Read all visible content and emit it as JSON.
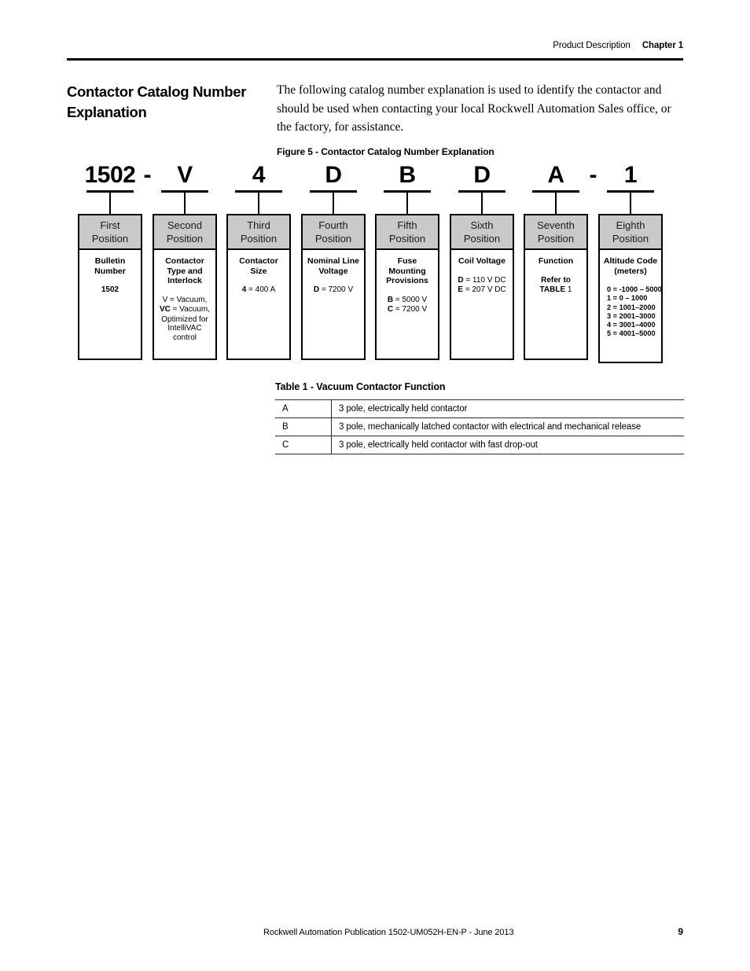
{
  "header": {
    "description": "Product Description",
    "chapter": "Chapter 1"
  },
  "section": {
    "title": "Contactor Catalog Number Explanation",
    "paragraph": "The following catalog number explanation is used to identify the contactor and should be used when contacting your local Rockwell Automation Sales office, or the factory, for assistance."
  },
  "figure": {
    "caption": "Figure 5 - Contactor Catalog Number Explanation",
    "catalog_string": "1502 - V 4 D B D A - 1",
    "characters": [
      "1502",
      "V",
      "4",
      "D",
      "B",
      "D",
      "A",
      "1"
    ],
    "separators": [
      "-",
      "-"
    ],
    "positions": [
      {
        "header": "First Position",
        "header_line1": "First",
        "header_line2": "Position",
        "title": "Bulletin Number",
        "lines": [
          "1502"
        ]
      },
      {
        "header": "Second Position",
        "header_line1": "Second",
        "header_line2": "Position",
        "title": "Contactor Type and Interlock",
        "lines": [
          "V  = Vacuum,",
          "VC = Vacuum,",
          "Optimized for",
          "IntelliVAC control"
        ]
      },
      {
        "header": "Third Position",
        "header_line1": "Third",
        "header_line2": "Position",
        "title": "Contactor Size",
        "lines": [
          "4 = 400 A"
        ]
      },
      {
        "header": "Fourth Position",
        "header_line1": "Fourth",
        "header_line2": "Position",
        "title": "Nominal Line Voltage",
        "lines": [
          "D = 7200 V"
        ]
      },
      {
        "header": "Fifth Position",
        "header_line1": "Fifth",
        "header_line2": "Position",
        "title": "Fuse Mounting Provisions",
        "lines": [
          "B  = 5000 V",
          "C  = 7200 V"
        ]
      },
      {
        "header": "Sixth Position",
        "header_line1": "Sixth",
        "header_line2": "Position",
        "title": "Coil Voltage",
        "lines": [
          "D = 110 V DC",
          "E = 207 V DC"
        ]
      },
      {
        "header": "Seventh Position",
        "header_line1": "Seventh",
        "header_line2": "Position",
        "title": "Function",
        "lines": [
          "Refer to",
          "TABLE 1"
        ]
      },
      {
        "header": "Eighth Position",
        "header_line1": "Eighth",
        "header_line2": "Position",
        "title": "Altitude Code (meters)",
        "lines": [
          "0 = -1000 – 5000",
          "1 = 0 – 1000",
          "2 = 1001–2000",
          "3 = 2001–3000",
          "4 = 3001–4000",
          "5 = 4001–5000"
        ]
      }
    ]
  },
  "table": {
    "caption": "Table 1 - Vacuum Contactor Function",
    "rows": [
      {
        "code": "A",
        "description": "3 pole, electrically held contactor"
      },
      {
        "code": "B",
        "description": "3 pole, mechanically latched contactor with electrical and mechanical release"
      },
      {
        "code": "C",
        "description": "3 pole, electrically held contactor with fast drop-out"
      }
    ]
  },
  "footer": {
    "publication": "Rockwell Automation Publication 1502-UM052H-EN-P - June 2013",
    "page_number": "9"
  },
  "colors": {
    "header_box_gray": "#c9c9c9",
    "rule_black": "#000000"
  }
}
